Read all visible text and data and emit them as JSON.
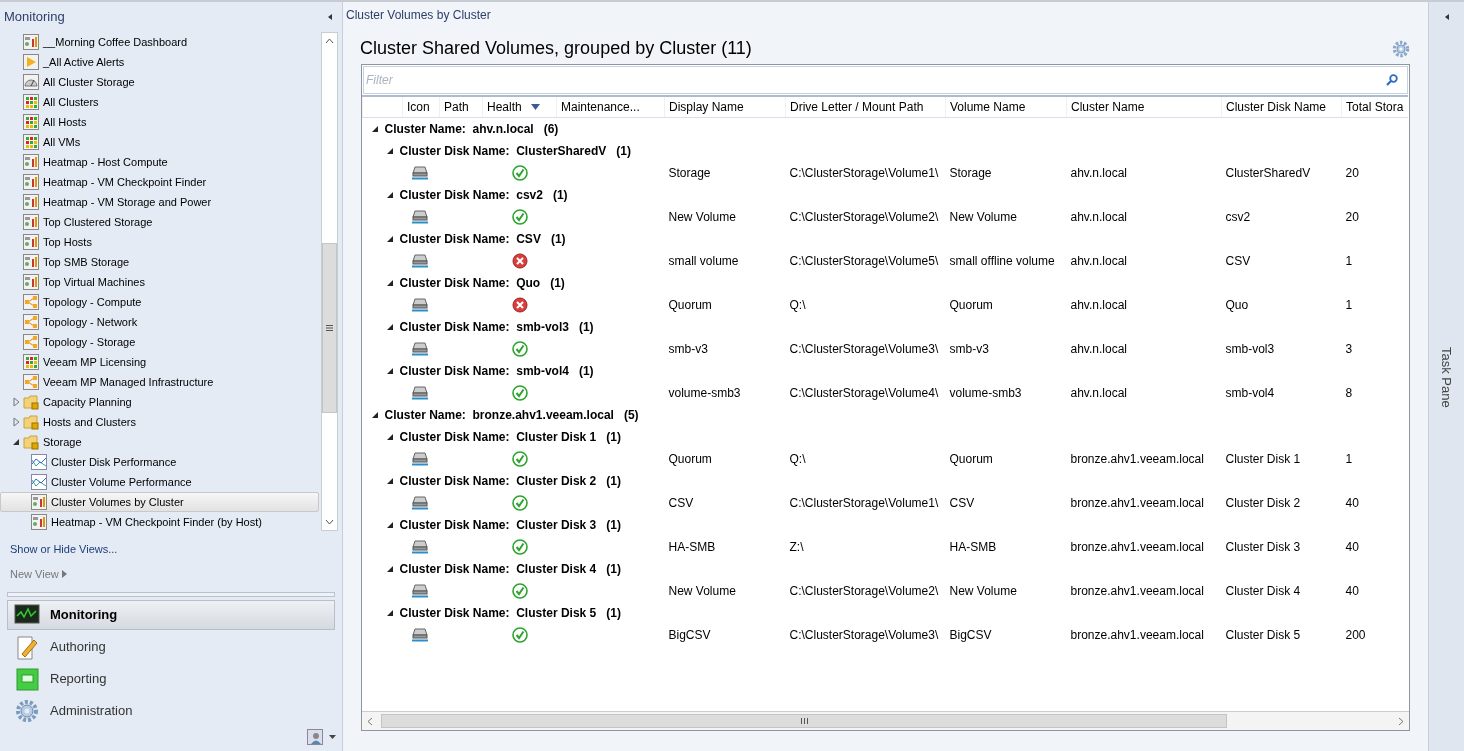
{
  "sidebar": {
    "title": "Monitoring",
    "tree": [
      {
        "label": "__Morning Coffee Dashboard",
        "kind": "dashboard",
        "selected": false
      },
      {
        "label": "_All Active Alerts",
        "kind": "alert",
        "selected": false
      },
      {
        "label": "All Cluster Storage",
        "kind": "gauge",
        "selected": false
      },
      {
        "label": "All Clusters",
        "kind": "state",
        "selected": false
      },
      {
        "label": "All Hosts",
        "kind": "state",
        "selected": false
      },
      {
        "label": "All VMs",
        "kind": "state",
        "selected": false
      },
      {
        "label": "Heatmap - Host Compute",
        "kind": "dashboard",
        "selected": false
      },
      {
        "label": "Heatmap - VM Checkpoint Finder",
        "kind": "dashboard",
        "selected": false
      },
      {
        "label": "Heatmap - VM Storage and Power",
        "kind": "dashboard",
        "selected": false
      },
      {
        "label": "Top Clustered Storage",
        "kind": "dashboard",
        "selected": false
      },
      {
        "label": "Top Hosts",
        "kind": "dashboard",
        "selected": false
      },
      {
        "label": "Top SMB Storage",
        "kind": "dashboard",
        "selected": false
      },
      {
        "label": "Top Virtual Machines",
        "kind": "dashboard",
        "selected": false
      },
      {
        "label": "Topology - Compute",
        "kind": "diagram",
        "selected": false
      },
      {
        "label": "Topology - Network",
        "kind": "diagram",
        "selected": false
      },
      {
        "label": "Topology - Storage",
        "kind": "diagram",
        "selected": false
      },
      {
        "label": "Veeam MP Licensing",
        "kind": "state",
        "selected": false
      },
      {
        "label": "Veeam MP Managed Infrastructure",
        "kind": "diagram",
        "selected": false
      },
      {
        "label": "Capacity Planning",
        "kind": "folder",
        "selected": false,
        "expanded": false
      },
      {
        "label": "Hosts and Clusters",
        "kind": "folder",
        "selected": false,
        "expanded": false
      },
      {
        "label": "Storage",
        "kind": "folder",
        "selected": false,
        "expanded": true,
        "children": [
          {
            "label": "Cluster Disk Performance",
            "kind": "performance",
            "selected": false
          },
          {
            "label": "Cluster Volume Performance",
            "kind": "performance",
            "selected": false
          },
          {
            "label": "Cluster Volumes by Cluster",
            "kind": "dashboard",
            "selected": true
          },
          {
            "label": "Heatmap - VM Checkpoint Finder (by Host)",
            "kind": "dashboard",
            "selected": false
          }
        ]
      }
    ],
    "show_hide_link": "Show or Hide Views...",
    "new_view": "New View",
    "nav": [
      {
        "label": "Monitoring",
        "kind": "monitoring",
        "selected": true
      },
      {
        "label": "Authoring",
        "kind": "authoring",
        "selected": false
      },
      {
        "label": "Reporting",
        "kind": "reporting",
        "selected": false
      },
      {
        "label": "Administration",
        "kind": "administration",
        "selected": false
      }
    ]
  },
  "main": {
    "breadcrumb": "Cluster Volumes by Cluster",
    "heading": "Cluster Shared Volumes, grouped by Cluster (11)",
    "filter": {
      "placeholder": "Filter"
    },
    "columns": [
      {
        "label": "Icon"
      },
      {
        "label": "Path"
      },
      {
        "label": "Health",
        "sorted": true
      },
      {
        "label": "Maintenance..."
      },
      {
        "label": "Display Name"
      },
      {
        "label": "Drive Letter / Mount Path"
      },
      {
        "label": "Volume Name"
      },
      {
        "label": "Cluster Name"
      },
      {
        "label": "Cluster Disk Name"
      },
      {
        "label": "Total Stora"
      }
    ],
    "groups": [
      {
        "label": "Cluster Name:",
        "value": "ahv.n.local",
        "count": "(6)",
        "expanded": true,
        "disks": [
          {
            "label": "Cluster Disk Name:",
            "value": "ClusterSharedV",
            "count": "(1)",
            "expanded": true,
            "rows": [
              {
                "kind": "ok",
                "cells": [
                  "Storage",
                  "C:\\ClusterStorage\\Volume1\\",
                  "Storage",
                  "ahv.n.local",
                  "ClusterSharedV",
                  "20"
                ]
              }
            ]
          },
          {
            "label": "Cluster Disk Name:",
            "value": "csv2",
            "count": "(1)",
            "expanded": true,
            "rows": [
              {
                "kind": "ok",
                "cells": [
                  "New Volume",
                  "C:\\ClusterStorage\\Volume2\\",
                  "New Volume",
                  "ahv.n.local",
                  "csv2",
                  "20"
                ]
              }
            ]
          },
          {
            "label": "Cluster Disk Name:",
            "value": "CSV",
            "count": "(1)",
            "expanded": true,
            "rows": [
              {
                "kind": "error",
                "cells": [
                  "small volume",
                  "C:\\ClusterStorage\\Volume5\\",
                  "small offline volume",
                  "ahv.n.local",
                  "CSV",
                  "1"
                ]
              }
            ]
          },
          {
            "label": "Cluster Disk Name:",
            "value": "Quo",
            "count": "(1)",
            "expanded": true,
            "rows": [
              {
                "kind": "error",
                "cells": [
                  "Quorum",
                  "Q:\\",
                  "Quorum",
                  "ahv.n.local",
                  "Quo",
                  "1"
                ]
              }
            ]
          },
          {
            "label": "Cluster Disk Name:",
            "value": "smb-vol3",
            "count": "(1)",
            "expanded": true,
            "rows": [
              {
                "kind": "ok",
                "cells": [
                  "smb-v3",
                  "C:\\ClusterStorage\\Volume3\\",
                  "smb-v3",
                  "ahv.n.local",
                  "smb-vol3",
                  "3"
                ]
              }
            ]
          },
          {
            "label": "Cluster Disk Name:",
            "value": "smb-vol4",
            "count": "(1)",
            "expanded": true,
            "rows": [
              {
                "kind": "ok",
                "cells": [
                  "volume-smb3",
                  "C:\\ClusterStorage\\Volume4\\",
                  "volume-smb3",
                  "ahv.n.local",
                  "smb-vol4",
                  "8"
                ]
              }
            ]
          }
        ]
      },
      {
        "label": "Cluster Name:",
        "value": "bronze.ahv1.veeam.local",
        "count": "(5)",
        "expanded": true,
        "disks": [
          {
            "label": "Cluster Disk Name:",
            "value": "Cluster Disk 1",
            "count": "(1)",
            "expanded": true,
            "rows": [
              {
                "kind": "ok",
                "cells": [
                  "Quorum",
                  "Q:\\",
                  "Quorum",
                  "bronze.ahv1.veeam.local",
                  "Cluster Disk 1",
                  "1"
                ]
              }
            ]
          },
          {
            "label": "Cluster Disk Name:",
            "value": "Cluster Disk 2",
            "count": "(1)",
            "expanded": true,
            "rows": [
              {
                "kind": "ok",
                "cells": [
                  "CSV",
                  "C:\\ClusterStorage\\Volume1\\",
                  "CSV",
                  "bronze.ahv1.veeam.local",
                  "Cluster Disk 2",
                  "40"
                ]
              }
            ]
          },
          {
            "label": "Cluster Disk Name:",
            "value": "Cluster Disk 3",
            "count": "(1)",
            "expanded": true,
            "rows": [
              {
                "kind": "ok",
                "cells": [
                  "HA-SMB",
                  "Z:\\",
                  "HA-SMB",
                  "bronze.ahv1.veeam.local",
                  "Cluster Disk 3",
                  "40"
                ]
              }
            ]
          },
          {
            "label": "Cluster Disk Name:",
            "value": "Cluster Disk 4",
            "count": "(1)",
            "expanded": true,
            "rows": [
              {
                "kind": "ok",
                "cells": [
                  "New Volume",
                  "C:\\ClusterStorage\\Volume2\\",
                  "New Volume",
                  "bronze.ahv1.veeam.local",
                  "Cluster Disk 4",
                  "40"
                ]
              }
            ]
          },
          {
            "label": "Cluster Disk Name:",
            "value": "Cluster Disk 5",
            "count": "(1)",
            "expanded": true,
            "rows": [
              {
                "kind": "ok",
                "cells": [
                  "BigCSV",
                  "C:\\ClusterStorage\\Volume3\\",
                  "BigCSV",
                  "bronze.ahv1.veeam.local",
                  "Cluster Disk 5",
                  "200"
                ]
              }
            ]
          }
        ]
      }
    ]
  },
  "task_pane": {
    "title": "Task Pane"
  }
}
